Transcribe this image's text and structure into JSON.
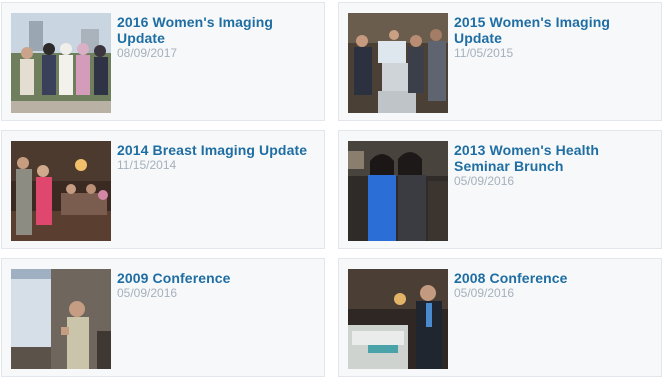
{
  "events": [
    {
      "title": "2016 Women's Imaging Update",
      "date": "08/09/2017"
    },
    {
      "title": "2015 Women's Imaging Update",
      "date": "11/05/2015"
    },
    {
      "title": "2014 Breast Imaging Update",
      "date": "11/15/2014"
    },
    {
      "title": "2013 Women's Health Seminar Brunch",
      "date": "05/09/2016"
    },
    {
      "title": "2009 Conference",
      "date": "05/09/2016"
    },
    {
      "title": "2008 Conference",
      "date": "05/09/2016"
    }
  ]
}
